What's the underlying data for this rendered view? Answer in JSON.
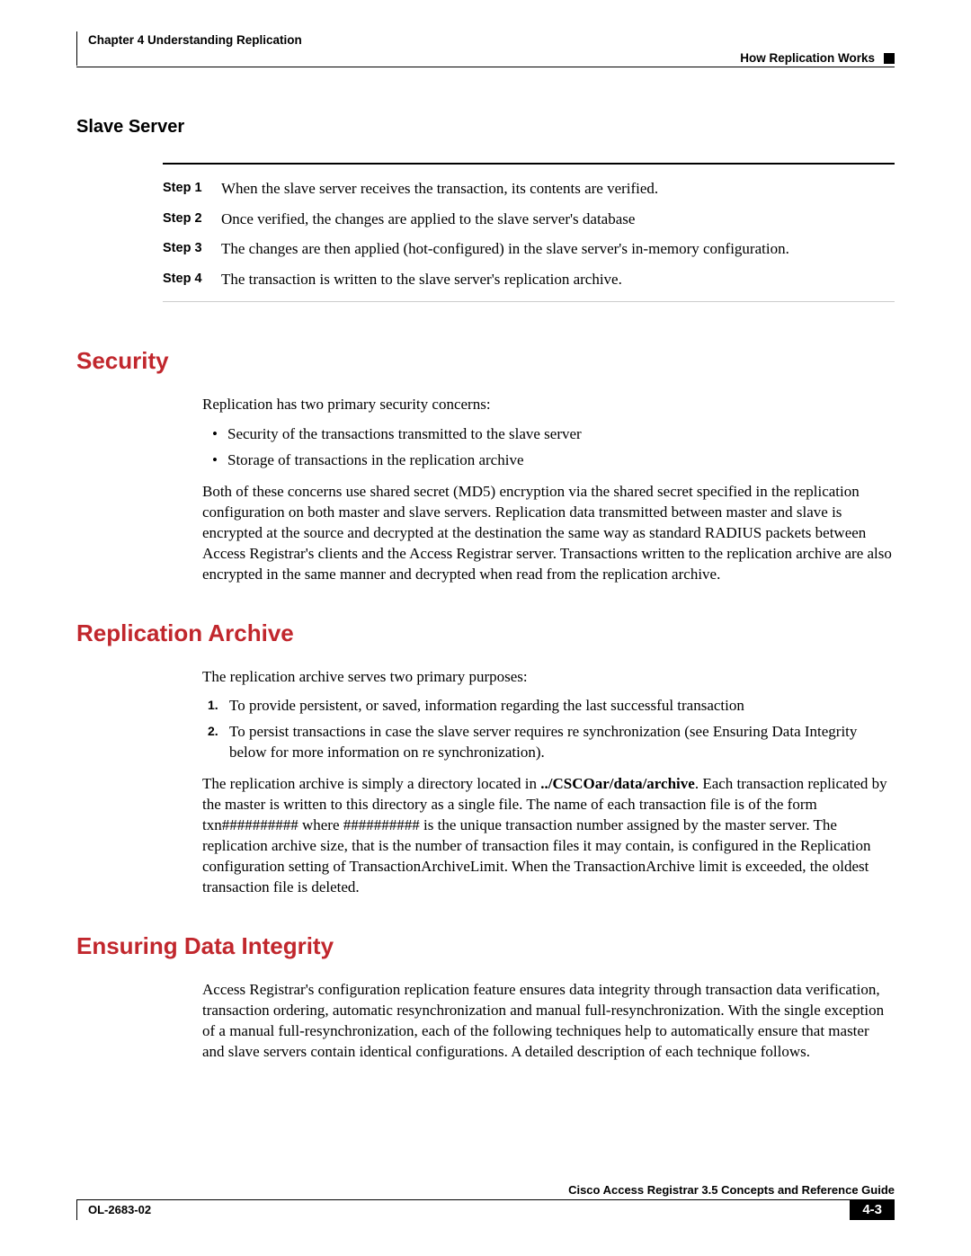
{
  "header": {
    "chapter": "Chapter 4      Understanding Replication",
    "section": "How Replication Works"
  },
  "slave_server": {
    "heading": "Slave Server",
    "steps": [
      {
        "label": "Step 1",
        "text": "When the slave server receives the transaction, its contents are verified."
      },
      {
        "label": "Step 2",
        "text": "Once verified, the changes are applied to the slave server's database"
      },
      {
        "label": "Step 3",
        "text": "The changes are then applied (hot-configured) in the slave server's in-memory configuration."
      },
      {
        "label": "Step 4",
        "text": "The transaction is written to the slave server's replication archive."
      }
    ]
  },
  "security": {
    "heading": "Security",
    "intro": "Replication has two primary security concerns:",
    "bullets": [
      "Security of the transactions transmitted to the slave server",
      "Storage of transactions in the replication archive"
    ],
    "para": "Both of these concerns use shared secret (MD5) encryption via the shared secret specified in the replication configuration on both master and slave servers. Replication data transmitted between master and slave is encrypted at the source and decrypted at the destination the same way as standard RADIUS packets between Access Registrar's clients and the Access Registrar server. Transactions written to the replication archive are also encrypted in the same manner and decrypted when read from the replication archive."
  },
  "archive": {
    "heading": "Replication Archive",
    "intro": "The replication archive serves two primary purposes:",
    "items": [
      "To provide persistent, or saved, information regarding the last successful transaction",
      "To persist transactions in case the slave server requires re synchronization (see Ensuring Data Integrity below for more information on re synchronization)."
    ],
    "para_pre": "The replication archive is simply a directory located in ",
    "para_bold": "../CSCOar/data/archive",
    "para_post": ". Each transaction replicated by the master is written to this directory as a single file. The name of each transaction file is of the form txn########## where ########## is the unique transaction number assigned by the master server. The replication archive size, that is the number of transaction files it may contain, is configured in the Replication configuration setting of TransactionArchiveLimit. When the TransactionArchive limit is exceeded, the oldest transaction file is deleted."
  },
  "integrity": {
    "heading": "Ensuring Data Integrity",
    "para": "Access Registrar's configuration replication feature ensures data integrity through transaction data verification, transaction ordering, automatic resynchronization and manual full-resynchronization. With the single exception of a manual full-resynchronization, each of the following techniques help to automatically ensure that master and slave servers contain identical configurations. A detailed description of each technique follows."
  },
  "footer": {
    "title": "Cisco Access Registrar 3.5 Concepts and Reference Guide",
    "docid": "OL-2683-02",
    "pagenum": "4-3"
  }
}
